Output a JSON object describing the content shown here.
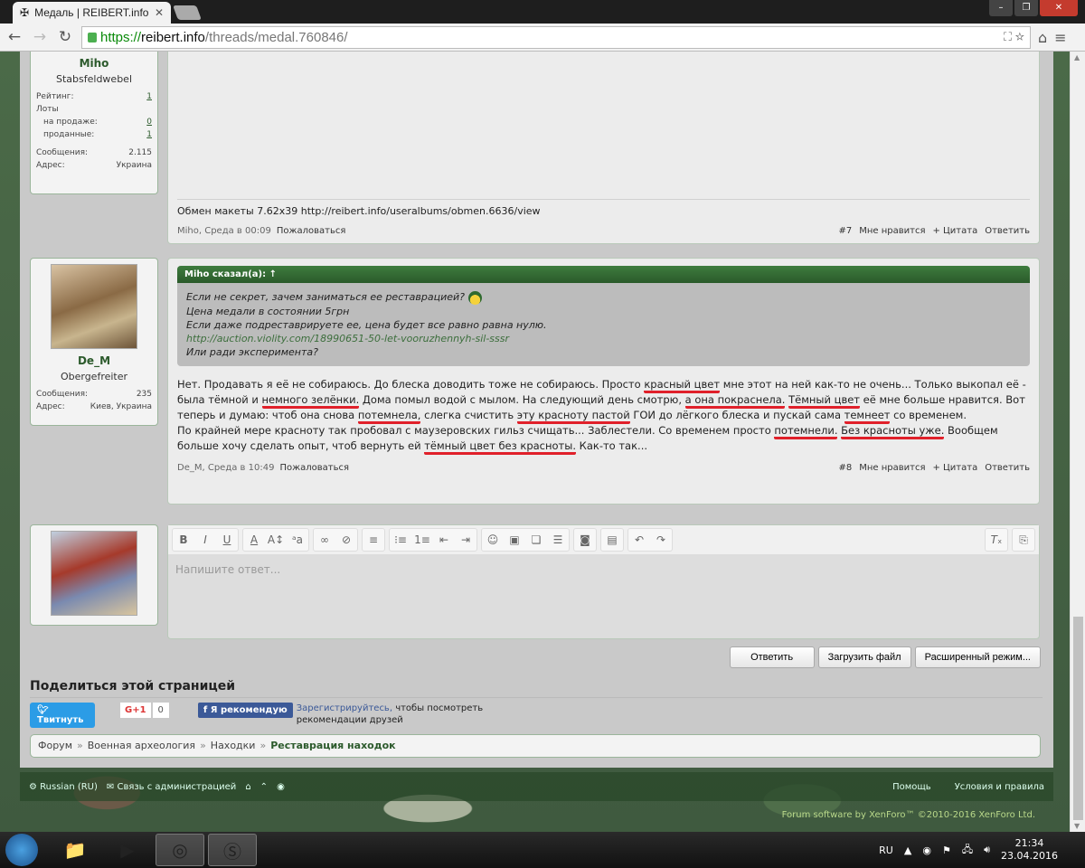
{
  "browser": {
    "tab_title": "Медаль | REIBERT.info",
    "url_scheme": "https://",
    "url_host": "reibert.info",
    "url_path": "/threads/medal.760846/"
  },
  "post7": {
    "user": {
      "name": "Miho",
      "title": "Stabsfeldwebel",
      "rating_label": "Рейтинг:",
      "rating": "1",
      "lots_label": "Лоты",
      "onsale_label": "на продаже:",
      "onsale": "0",
      "sold_label": "проданные:",
      "sold": "1",
      "messages_label": "Сообщения:",
      "messages": "2.115",
      "address_label": "Адрес:",
      "address": "Украина"
    },
    "signature": "Обмен макеты 7.62x39 http://reibert.info/useralbums/obmen.6636/view",
    "author_date": "Miho, Среда в 00:09",
    "report": "Пожаловаться",
    "number": "#7",
    "like": "Мне нравится",
    "quote": "+ Цитата",
    "reply": "Ответить"
  },
  "post8": {
    "user": {
      "name": "De_M",
      "title": "Obergefreiter",
      "messages_label": "Сообщения:",
      "messages": "235",
      "address_label": "Адрес:",
      "address": "Киев, Украина"
    },
    "quote_head": "Miho сказал(а): ↑",
    "quote_lines": [
      "Если не секрет, зачем заниматься ее реставрацией?",
      "Цена медали в состоянии 5грн",
      "Если даже подреставрируете ее, цена будет все равно равна нулю.",
      "http://auction.violity.com/18990651-50-let-vooruzhennyh-sil-sssr",
      "Или ради эксперимента?"
    ],
    "paragraphs": [
      [
        {
          "t": "Нет. Продавать я её не собираюсь. До блеска доводить тоже не собираюсь. Просто "
        },
        {
          "t": "красный цвет",
          "u": true
        },
        {
          "t": " мне этот на ней как-то не очень... Только выкопал её - была тёмной и "
        },
        {
          "t": "немного зелёнки.",
          "u": true
        },
        {
          "t": " Дома помыл водой с мылом. На следующий день смотрю, "
        },
        {
          "t": "а она покраснела.",
          "u": true
        },
        {
          "t": " "
        },
        {
          "t": "Тёмный цвет",
          "u": true
        },
        {
          "t": " её мне больше нравится. Вот теперь и думаю: чтоб она снова "
        },
        {
          "t": "потемнела,",
          "u": true
        },
        {
          "t": " слегка счистить "
        },
        {
          "t": "эту красноту пастой",
          "u": true
        },
        {
          "t": " ГОИ до лёгкого блеска и пускай сама "
        },
        {
          "t": "темнеет",
          "u": true
        },
        {
          "t": " со временем."
        }
      ],
      [
        {
          "t": "По крайней мере красноту так пробовал с маузеровских гильз счищать... Заблестели. Со временем просто "
        },
        {
          "t": "потемнели.",
          "u": true
        },
        {
          "t": " "
        },
        {
          "t": "Без красноты уже.",
          "u": true
        },
        {
          "t": " Вообщем больше хочу сделать опыт, чтоб вернуть ей "
        },
        {
          "t": "тёмный цвет без красноты.",
          "u": true
        },
        {
          "t": " Как-то так..."
        }
      ]
    ],
    "author_date": "De_M, Среда в 10:49",
    "report": "Пожаловаться",
    "number": "#8",
    "like": "Мне нравится",
    "quote": "+ Цитата",
    "reply": "Ответить"
  },
  "editor": {
    "placeholder": "Напишите ответ...",
    "reply_btn": "Ответить",
    "upload_btn": "Загрузить файл",
    "advanced_btn": "Расширенный режим..."
  },
  "share": {
    "heading": "Поделиться этой страницей",
    "tweet": "Твитнуть",
    "gplus": "G+1",
    "gplus_count": "0",
    "fb": "Я рекомендую",
    "fb_register": "Зарегистрируйтесь,",
    "fb_text": " чтобы посмотреть рекомендации друзей"
  },
  "breadcrumb": [
    "Форум",
    "Военная археология",
    "Находки",
    "Реставрация находок"
  ],
  "footer": {
    "language": "Russian (RU)",
    "contact": "Связь с администрацией",
    "help": "Помощь",
    "terms": "Условия и правила",
    "copyright": "Forum software by XenForo™ ©2010-2016 XenForo Ltd."
  },
  "taskbar": {
    "lang": "RU",
    "time": "21:34",
    "date": "23.04.2016"
  }
}
